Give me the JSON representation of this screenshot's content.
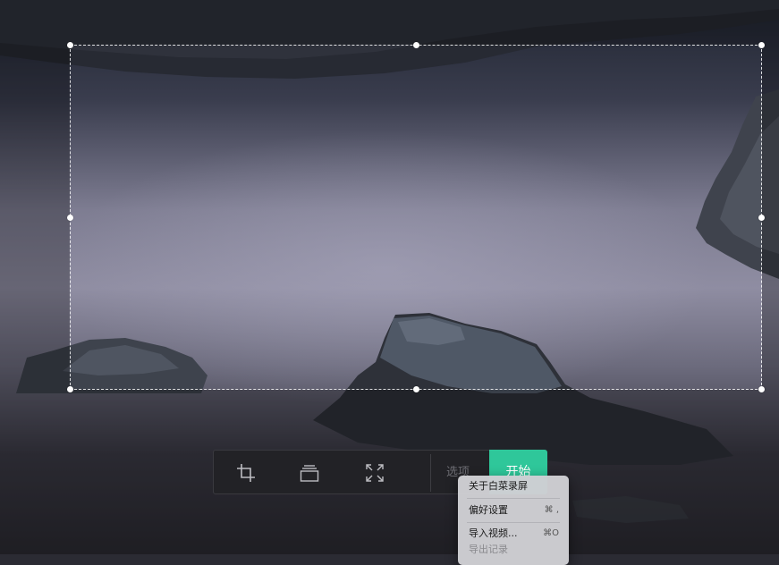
{
  "toolbar": {
    "tools": [
      {
        "icon": "crop-icon"
      },
      {
        "icon": "window-stack-icon"
      },
      {
        "icon": "fullscreen-icon"
      }
    ],
    "options_label": "选项",
    "start_label": "开始",
    "accent_color": "#2fc79a"
  },
  "menu": {
    "items": [
      {
        "label": "关于白菜录屏",
        "shortcut": ""
      },
      {
        "label": "偏好设置",
        "shortcut": "⌘ ,"
      },
      {
        "label": "导入视频...",
        "shortcut": "⌘O"
      },
      {
        "label": "导出记录",
        "shortcut": ""
      }
    ]
  }
}
